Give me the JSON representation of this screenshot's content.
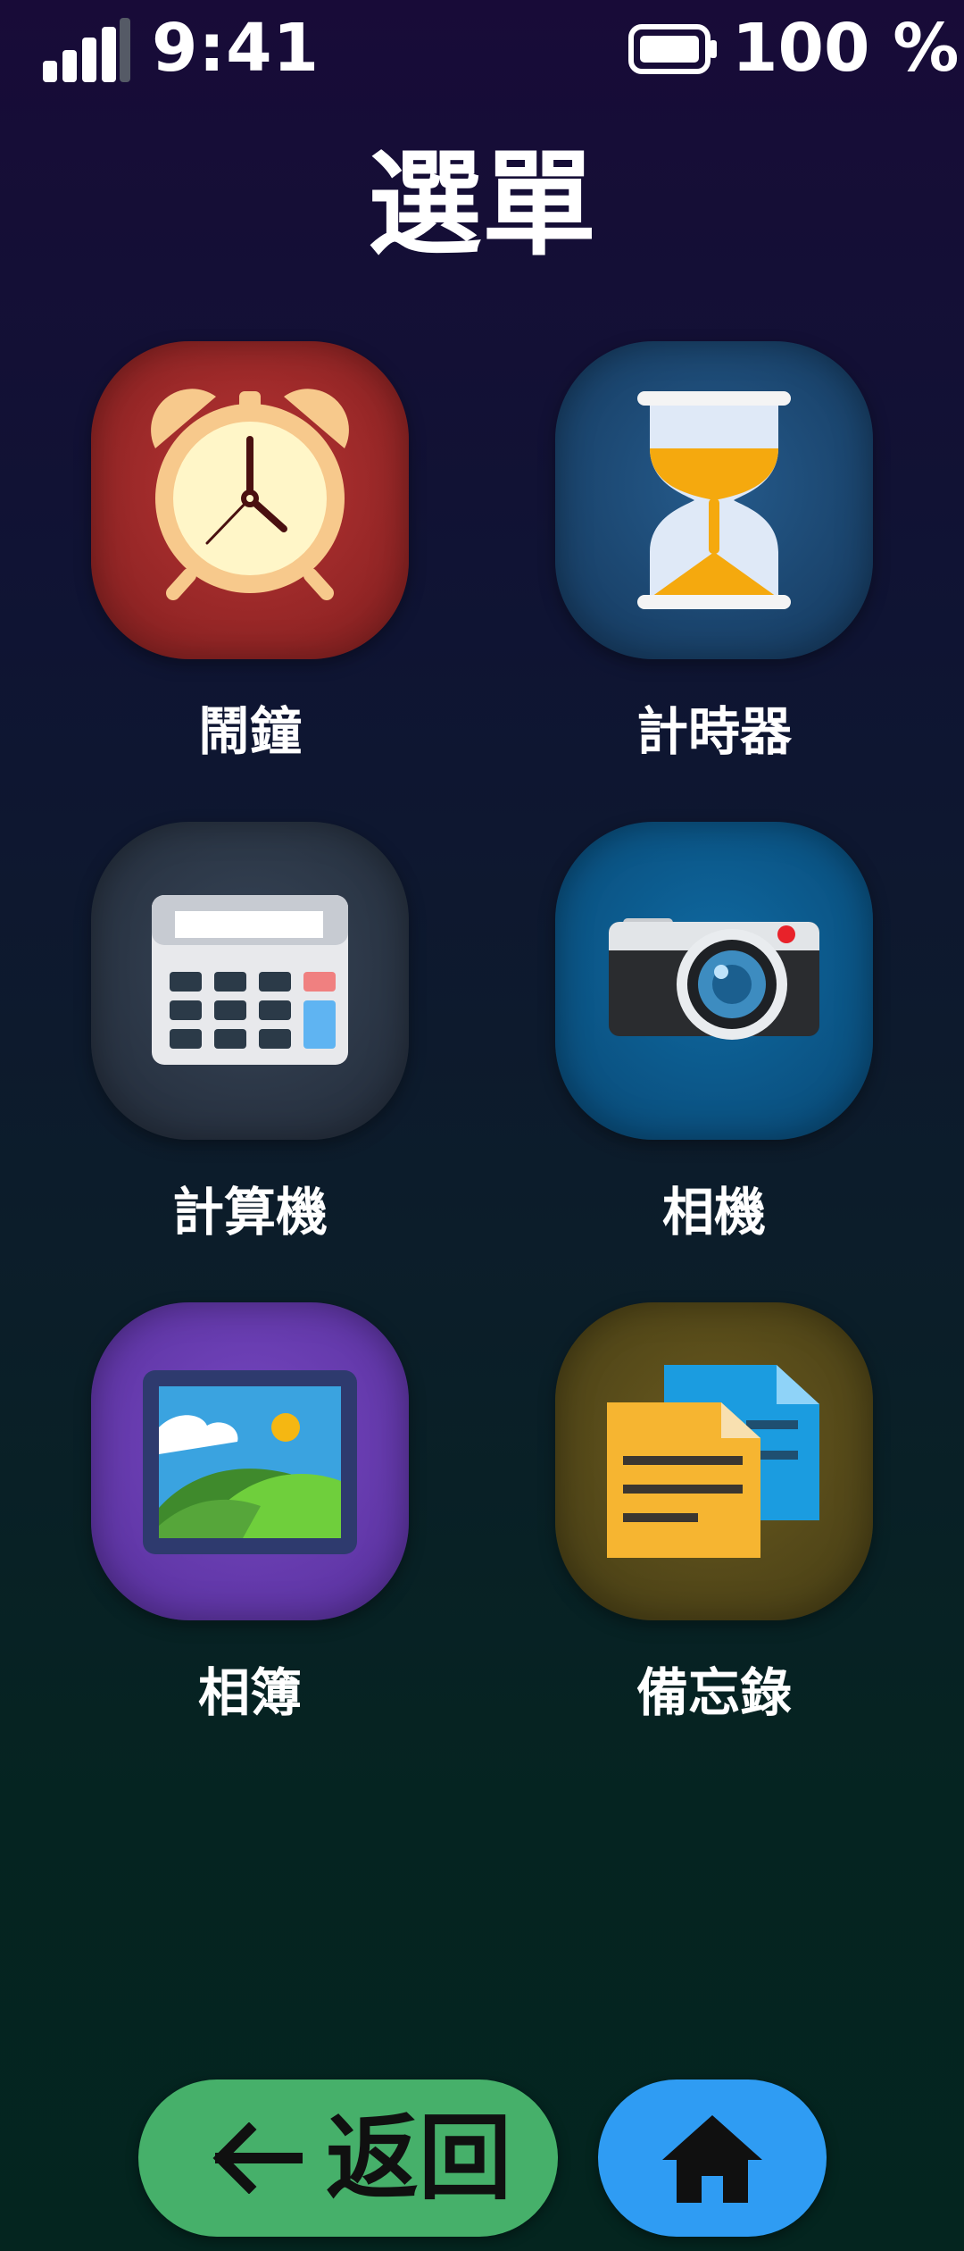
{
  "status_bar": {
    "time": "9:41",
    "battery_text": "100 %"
  },
  "page": {
    "title": "選單"
  },
  "apps": [
    {
      "id": "alarm",
      "label": "鬧鐘",
      "icon": "alarm-clock-icon",
      "color": "#9b2a2a"
    },
    {
      "id": "timer",
      "label": "計時器",
      "icon": "hourglass-icon",
      "color": "#1d4b78"
    },
    {
      "id": "calculator",
      "label": "計算機",
      "icon": "calculator-icon",
      "color": "#2c3848"
    },
    {
      "id": "camera",
      "label": "相機",
      "icon": "camera-icon",
      "color": "#0b5a8a"
    },
    {
      "id": "gallery",
      "label": "相簿",
      "icon": "photo-icon",
      "color": "#6a3fb0"
    },
    {
      "id": "notes",
      "label": "備忘錄",
      "icon": "documents-icon",
      "color": "#5a4d1a"
    }
  ],
  "nav": {
    "back_label": "返回",
    "back_color": "#46b06a",
    "home_color": "#2f9cf3"
  }
}
